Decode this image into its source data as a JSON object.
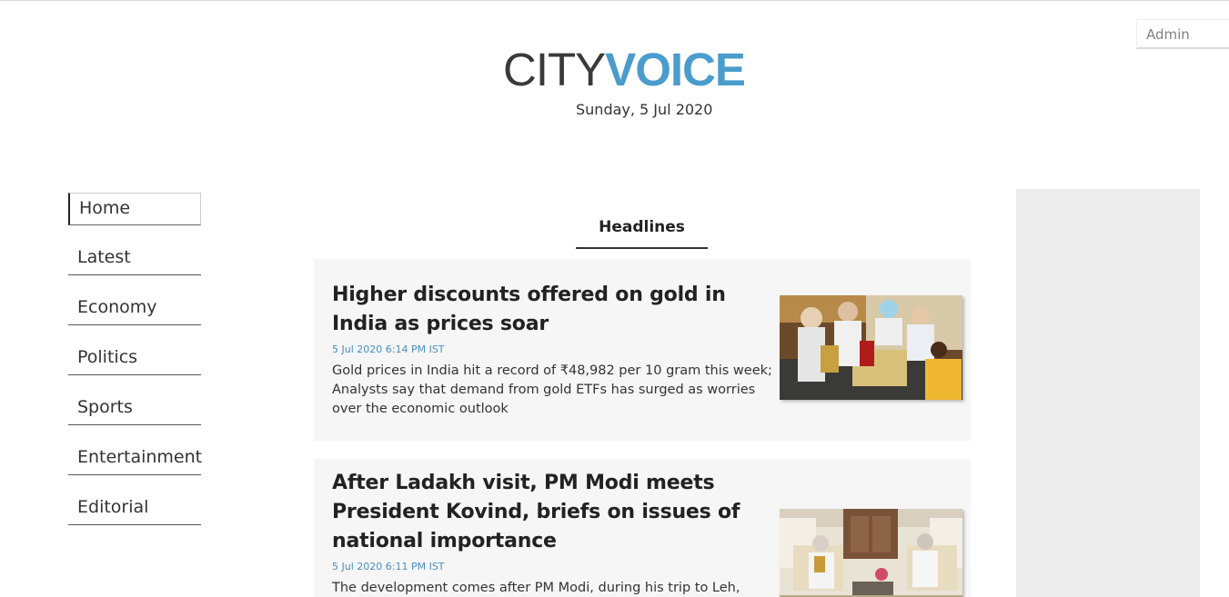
{
  "header": {
    "logo_part1": "CITY",
    "logo_part2": "VOICE",
    "date": "Sunday, 5 Jul 2020",
    "admin_label": "Admin"
  },
  "nav": {
    "items": [
      {
        "label": "Home"
      },
      {
        "label": "Latest"
      },
      {
        "label": "Economy"
      },
      {
        "label": "Politics"
      },
      {
        "label": "Sports"
      },
      {
        "label": "Entertainment"
      },
      {
        "label": "Editorial"
      }
    ]
  },
  "tabs": {
    "headlines": "Headlines"
  },
  "articles": [
    {
      "title": "Higher discounts offered on gold in India as prices soar",
      "timestamp": "5 Jul 2020 6:14 PM IST",
      "summary": "Gold prices in India hit a record of ₹48,982 per 10 gram this week; Analysts say that demand from gold ETFs has surged as worries over the economic outlook"
    },
    {
      "title": "After Ladakh visit, PM Modi meets President Kovind, briefs on issues of national importance",
      "timestamp": "5 Jul 2020 6:11 PM IST",
      "summary": "The development comes after PM Modi, during his trip to Leh,"
    }
  ],
  "colors": {
    "accent": "#4a9ccc",
    "card_bg": "#f6f6f6",
    "side_panel": "#ececec"
  }
}
